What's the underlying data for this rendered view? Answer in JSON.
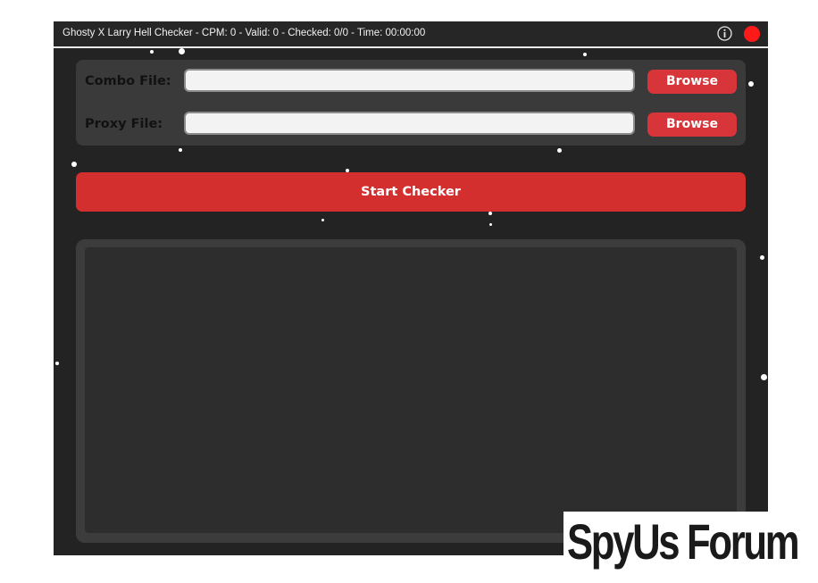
{
  "window": {
    "title": "Ghosty X Larry Hell Checker - CPM: 0 - Valid: 0 - Checked: 0/0 - Time: 00:00:00",
    "icons": {
      "info": "info-icon",
      "close": "close-icon"
    },
    "colors": {
      "background": "#232323",
      "accent": "#d32f2f",
      "close": "#ff1a1a"
    }
  },
  "form": {
    "combo_label": "Combo File:",
    "combo_value": "",
    "proxy_label": "Proxy File:",
    "proxy_value": "",
    "browse_label": "Browse"
  },
  "actions": {
    "start_label": "Start Checker"
  },
  "log": {
    "text": ""
  },
  "watermark": {
    "text": "SpyUs Forum"
  }
}
